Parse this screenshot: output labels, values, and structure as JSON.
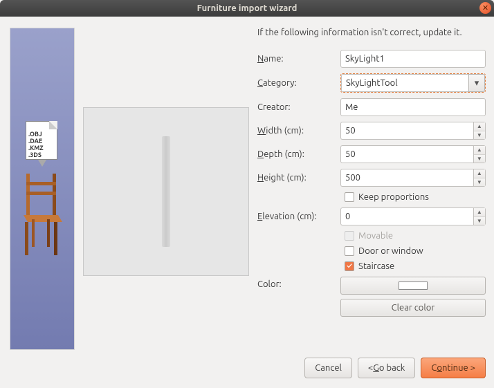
{
  "title": "Furniture import wizard",
  "instruction": "If the following information isn't correct, update it.",
  "sidebar_formats": ".OBJ\n.DAE\n.KMZ\n.3DS",
  "labels": {
    "name": "ame:",
    "category": "ategory:",
    "creator": "Creator:",
    "width": "idth (cm):",
    "depth": "epth (cm):",
    "height": "eight (cm):",
    "keep": "eep proportions",
    "elevation": "levation (cm):",
    "movable": "ovable",
    "door": "oor or window",
    "staircase": "taircase",
    "color": "Color:"
  },
  "mnemonics": {
    "name": "N",
    "category": "C",
    "width": "W",
    "depth": "D",
    "height": "H",
    "keep": "K",
    "elevation": "E",
    "movable": "M",
    "door": "D",
    "staircase": "S",
    "goback": "G",
    "continue": "o"
  },
  "values": {
    "name": "SkyLight1",
    "category": "SkyLightTool",
    "creator": "Me",
    "width": "50",
    "depth": "50",
    "height": "500",
    "elevation": "0"
  },
  "checkboxes": {
    "keep": false,
    "movable": false,
    "movable_disabled": true,
    "door": false,
    "staircase": true
  },
  "buttons": {
    "clear_color": "Clear color",
    "cancel": "Cancel",
    "goback": "< Go back",
    "continue_pre": "C",
    "continue_post": "ntinue >"
  }
}
